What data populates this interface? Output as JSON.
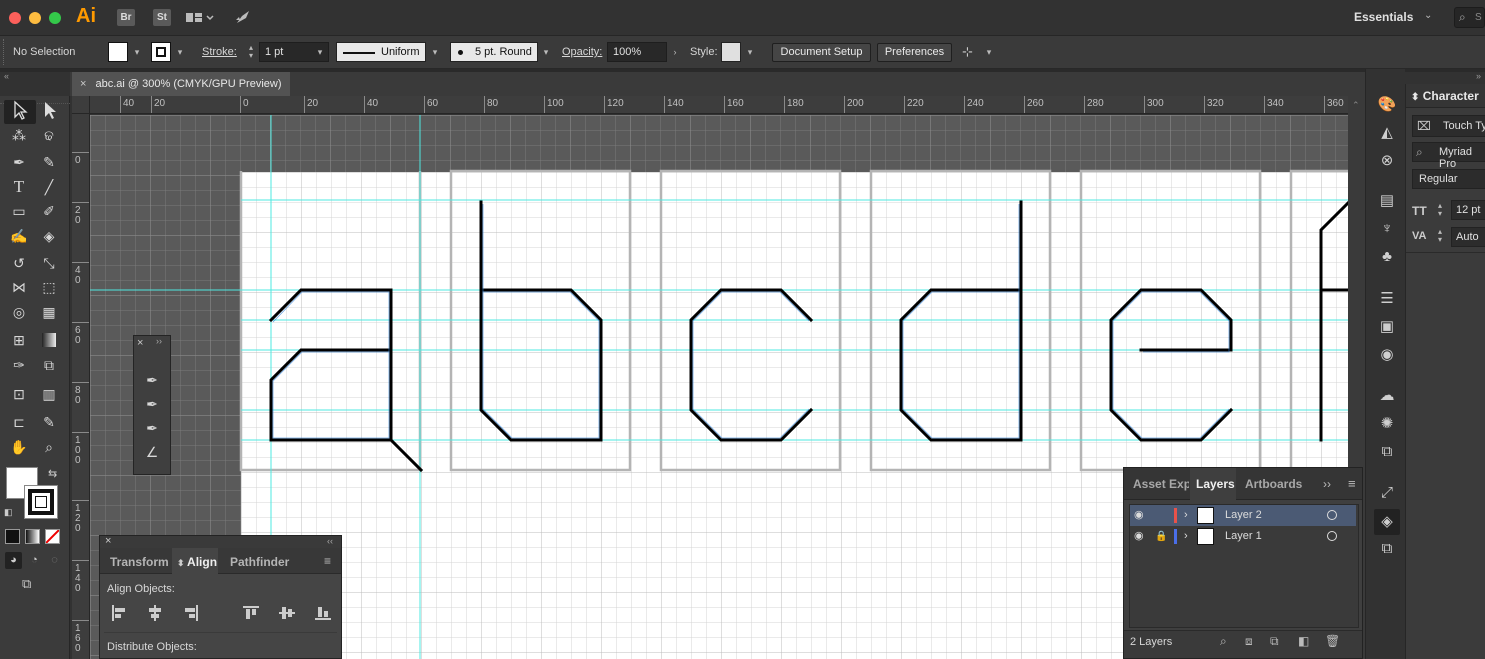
{
  "app": {
    "logo": "Ai",
    "bridge": "Br",
    "stock": "St",
    "workspace": "Essentials",
    "search_placeholder": "S"
  },
  "control_bar": {
    "selection": "No Selection",
    "stroke_label": "Stroke:",
    "stroke_weight": "1 pt",
    "stroke_profile": "Uniform",
    "brush": "5 pt. Round",
    "opacity_label": "Opacity:",
    "opacity_value": "100%",
    "style_label": "Style:",
    "document_setup": "Document Setup",
    "preferences": "Preferences"
  },
  "document": {
    "tab_title": "abc.ai @ 300% (CMYK/GPU Preview)"
  },
  "ruler": {
    "h_ticks": [
      "40",
      "20",
      "0",
      "20",
      "40",
      "60",
      "80",
      "100",
      "120",
      "140",
      "160",
      "180",
      "200",
      "220",
      "240",
      "260",
      "280",
      "300",
      "320",
      "340",
      "360"
    ],
    "v_ticks": [
      "0",
      "2\n0",
      "4\n0",
      "6\n0",
      "8\n0",
      "1\n0\n0",
      "1\n2\n0",
      "1\n4\n0",
      "1\n6\n0"
    ]
  },
  "align_panel": {
    "tabs": [
      "Transform",
      "Align",
      "Pathfinder"
    ],
    "active_tab": "Align",
    "align_objects": "Align Objects:",
    "distribute_objects": "Distribute Objects:"
  },
  "layers_panel": {
    "tabs": [
      "Asset Expo",
      "Layers",
      "Artboards"
    ],
    "active_tab": "Layers",
    "layers": [
      {
        "name": "Layer 2",
        "color": "#e8524a",
        "selected": true,
        "locked": false
      },
      {
        "name": "Layer 1",
        "color": "#4a6ee8",
        "selected": false,
        "locked": true
      }
    ],
    "count": "2 Layers"
  },
  "character_panel": {
    "title": "Character",
    "touch_type": "Touch Ty",
    "font_family": "Myriad Pro",
    "font_style": "Regular",
    "font_size": "12 pt",
    "leading": "Auto"
  },
  "icons": [
    "selection-tool",
    "direct-selection-tool",
    "magic-wand",
    "lasso",
    "pen",
    "curvature",
    "type",
    "line-segment",
    "rectangle",
    "paintbrush",
    "shaper",
    "eraser",
    "rotate",
    "scale",
    "width",
    "free-transform",
    "shape-builder",
    "perspective-grid",
    "mesh",
    "gradient",
    "eyedropper",
    "blend",
    "symbol-sprayer",
    "column-graph",
    "artboard",
    "slice",
    "hand",
    "zoom"
  ]
}
